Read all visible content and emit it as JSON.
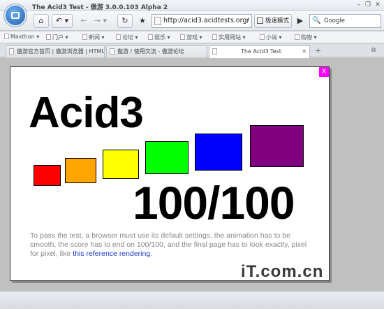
{
  "window": {
    "title": "The Acid3 Test - 傲游 3.0.0.103 Alpha 2",
    "controls": {
      "minimize": "–",
      "restore": "❐",
      "close": "✕"
    }
  },
  "toolbar": {
    "home_icon": "⌂",
    "undo_icon": "↶",
    "back_icon": "←",
    "forward_icon": "→",
    "reload_icon": "↻",
    "favorite_icon": "★",
    "url": "http://acid3.acidtests.org/",
    "compat_label": "极速模式",
    "go_icon": "▶",
    "search_placeholder": "Google",
    "search_icon": "🔍"
  },
  "bookmarks": [
    {
      "label": "Maxthon"
    },
    {
      "label": "门户"
    },
    {
      "label": "新闻"
    },
    {
      "label": "论坛"
    },
    {
      "label": "娱乐"
    },
    {
      "label": "游戏"
    },
    {
      "label": "实用网站"
    },
    {
      "label": "小说"
    },
    {
      "label": "购物"
    }
  ],
  "tabs": [
    {
      "label": "傲游官方首页 | 傲游浏览器 | HTML"
    },
    {
      "label": "傲游 / 使用交流 - 傲游论坛"
    },
    {
      "label": "The Acid3 Test"
    }
  ],
  "page": {
    "close_label": "X",
    "heading": "Acid3",
    "score": "100/100",
    "note_text": "To pass the test, a browser must use its default settings, the animation has to be smooth, the score has to end on 100/100, and the final page has to look exactly, pixel for pixel, like ",
    "link_text": "this reference rendering",
    "note_end": ".",
    "watermark": "iT.com.cn"
  },
  "colors": {
    "sq1": "#ff0000",
    "sq2": "#ffa500",
    "sq3": "#ffff00",
    "sq4": "#00ff00",
    "sq5": "#0000ff",
    "sq6": "#800080",
    "close_bg": "#ff00ff",
    "link": "#1c3cc7"
  }
}
